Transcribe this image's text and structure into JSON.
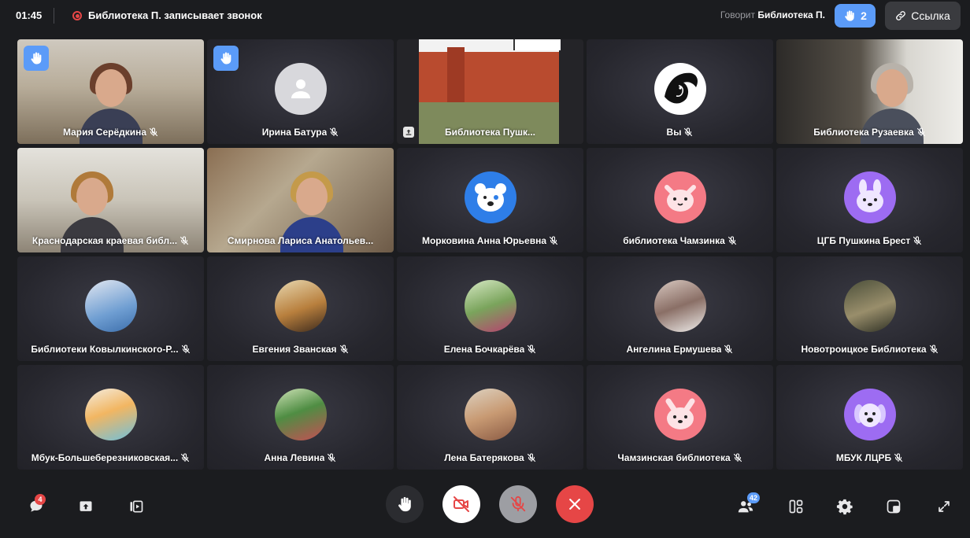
{
  "topbar": {
    "timer": "01:45",
    "recording_text": "Библиотека П. записывает звонок",
    "speaking_label": "Говорит",
    "speaking_name": "Библиотека П.",
    "raised_hands_count": "2",
    "link_label": "Ссылка"
  },
  "participants": [
    {
      "name": "Мария Серёдкина",
      "hand": true
    },
    {
      "name": "Ирина Батура",
      "hand": true
    },
    {
      "name": "Библиотека Пушк..."
    },
    {
      "name": "Вы"
    },
    {
      "name": "Библиотека Рузаевка"
    },
    {
      "name": "Краснодарская краевая библ..."
    },
    {
      "name": "Смирнова Лариса Анатольев..."
    },
    {
      "name": "Морковина Анна Юрьевна"
    },
    {
      "name": "библиотека Чамзинка"
    },
    {
      "name": "ЦГБ Пушкина Брест"
    },
    {
      "name": "Библиотеки Ковылкинского-Р..."
    },
    {
      "name": "Евгения Званская"
    },
    {
      "name": "Елена Бочкарёва"
    },
    {
      "name": "Ангелина Ермушева"
    },
    {
      "name": "Новотроицкое Библиотека"
    },
    {
      "name": "Мбук-Большеберезниковская..."
    },
    {
      "name": "Анна Левина"
    },
    {
      "name": "Лена Батерякова"
    },
    {
      "name": "Чамзинская библиотека"
    },
    {
      "name": "МБУК ЛЦРБ"
    }
  ],
  "bottombar": {
    "chat_badge": "4",
    "participants_badge": "42"
  },
  "colors": {
    "accent": "#5b9bf8",
    "danger": "#e64646",
    "background": "#1b1c1f"
  }
}
